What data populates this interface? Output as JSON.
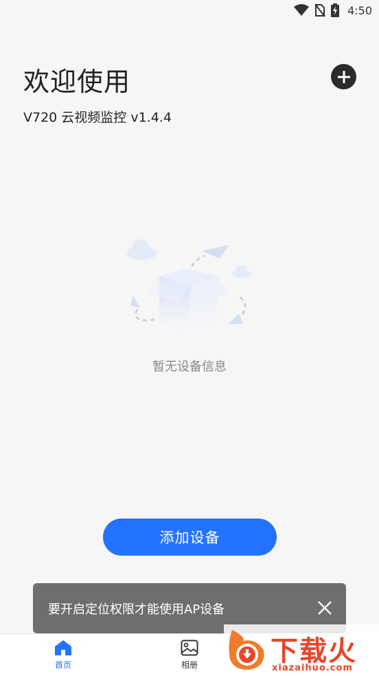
{
  "status_bar": {
    "time": "4:50"
  },
  "header": {
    "title": "欢迎使用",
    "subtitle": "V720 云视频监控 v1.4.4"
  },
  "empty_state": {
    "message": "暂无设备信息"
  },
  "primary_action": {
    "label": "添加设备"
  },
  "toast": {
    "message": "要开启定位权限才能使用AP设备"
  },
  "tab_bar": {
    "items": [
      {
        "label": "首页",
        "icon": "home-icon",
        "active": true
      },
      {
        "label": "相册",
        "icon": "album-icon",
        "active": false
      }
    ]
  },
  "watermark": {
    "title": "下载火",
    "url": "xiazaihuo.com"
  },
  "colors": {
    "accent": "#2473ff",
    "toast_bg": "#6e6e6e",
    "watermark": "#e8462b"
  }
}
